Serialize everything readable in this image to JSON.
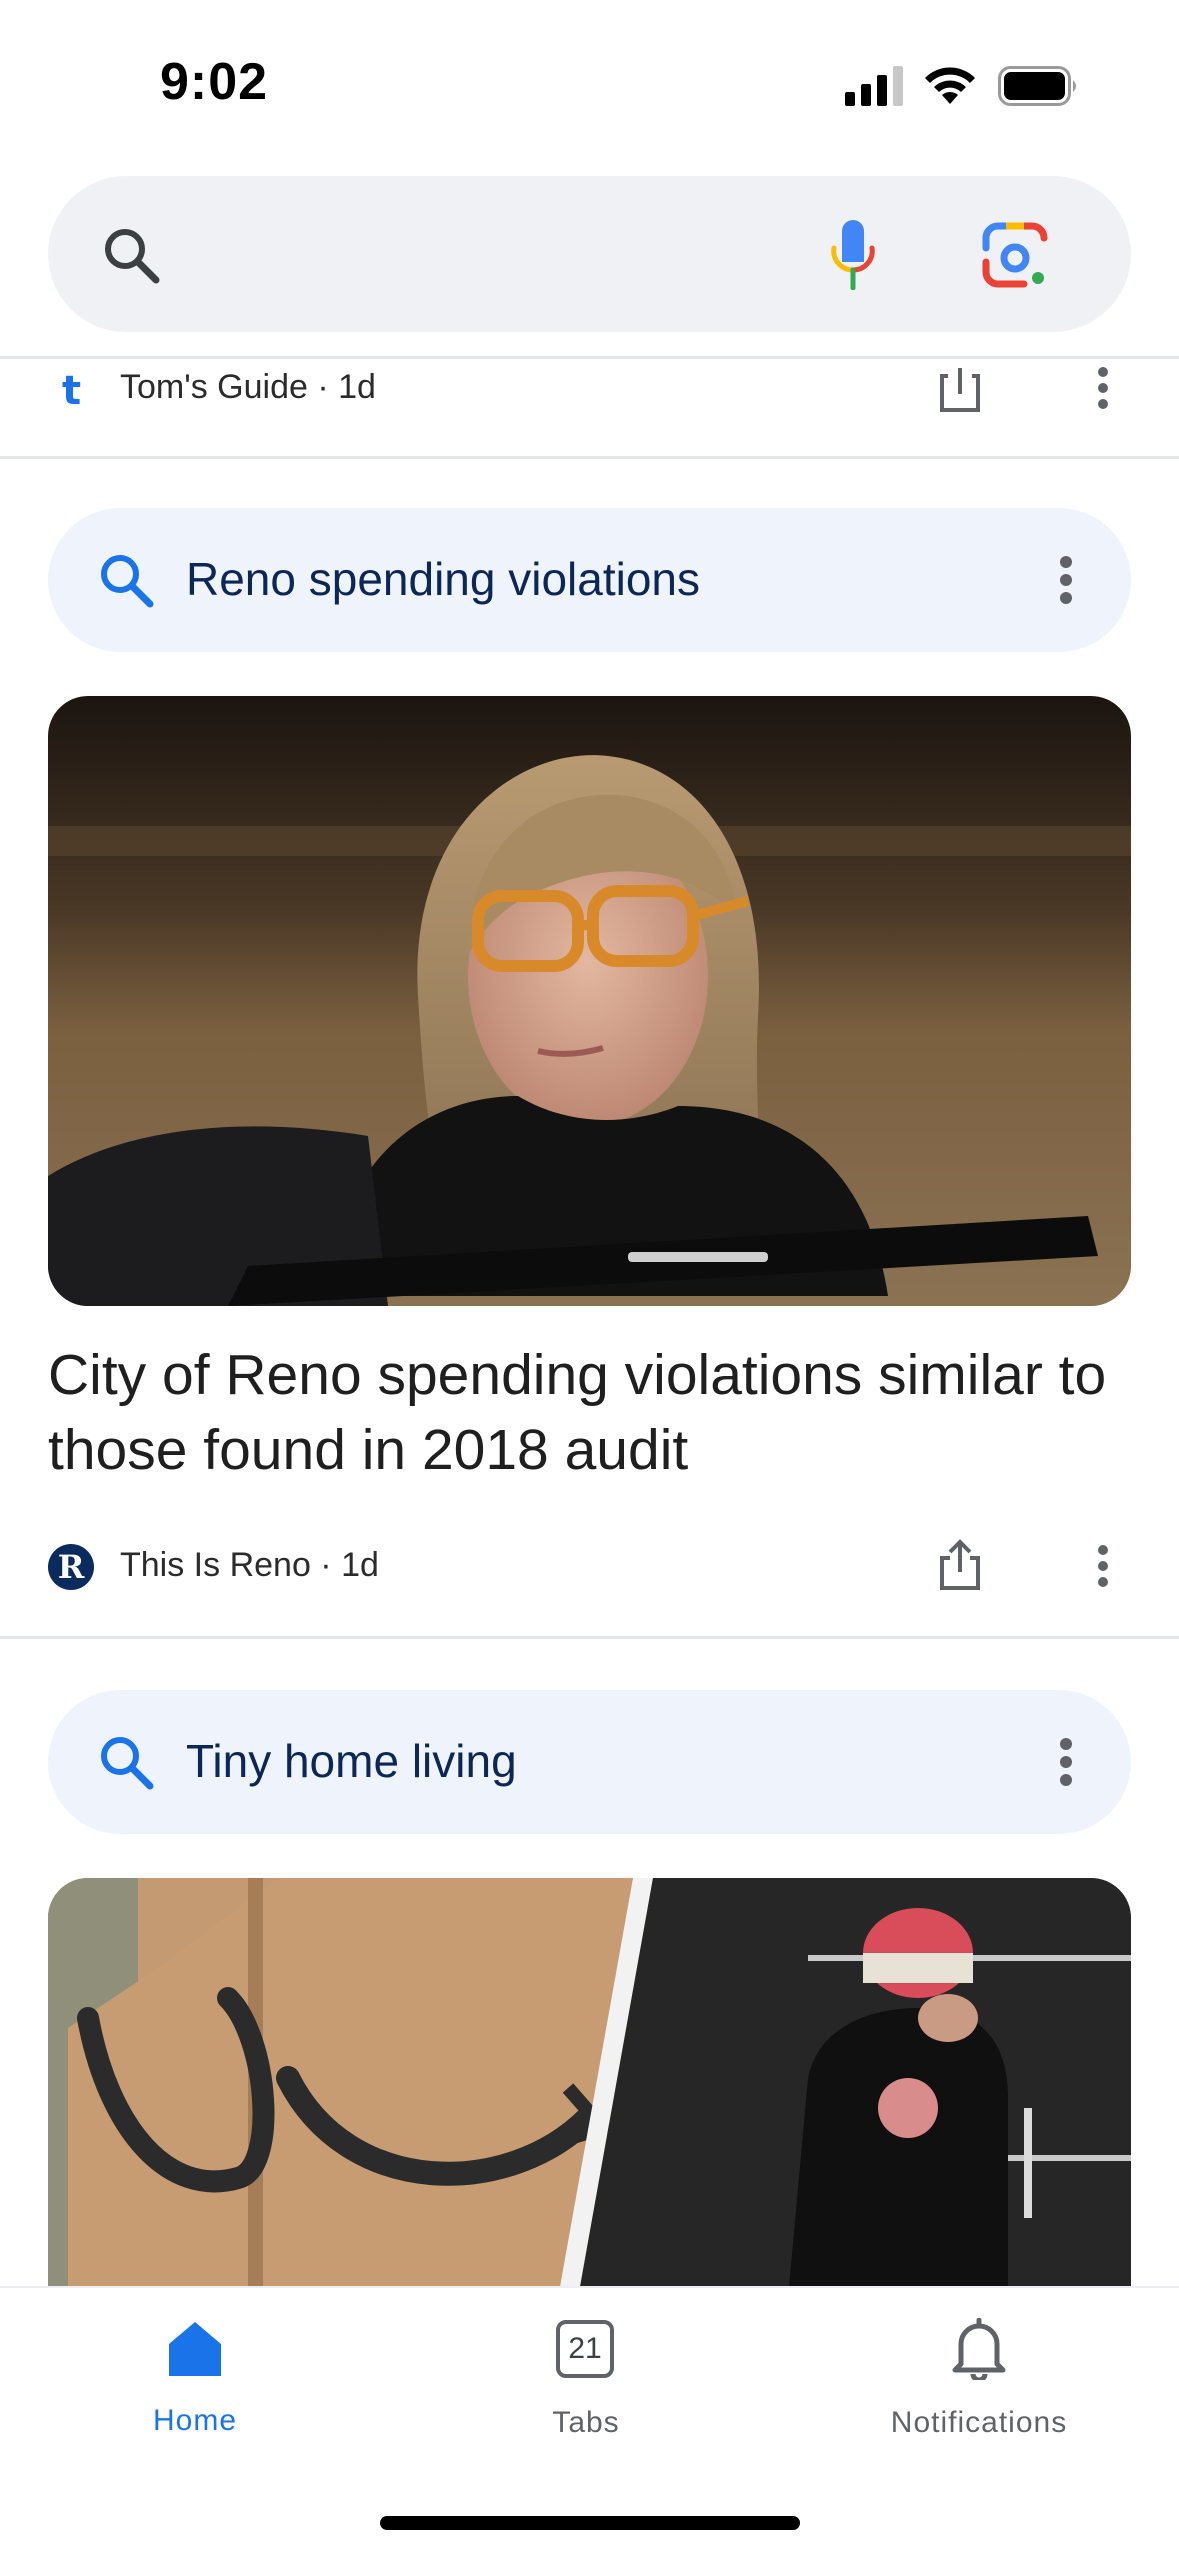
{
  "status_bar": {
    "time": "9:02"
  },
  "search": {
    "placeholder": ""
  },
  "partial_card": {
    "source": "Tom's Guide · 1d"
  },
  "cards": [
    {
      "topic": "Reno spending violations",
      "headline": "City of Reno spending violations similar to those found in 2018 audit",
      "source": "This Is Reno · 1d",
      "source_logo_letter": "R"
    },
    {
      "topic": "Tiny home living"
    }
  ],
  "bottom_nav": {
    "home_label": "Home",
    "tabs_label": "Tabs",
    "tabs_count": "21",
    "notifications_label": "Notifications"
  },
  "colors": {
    "accent_blue": "#1a73e8",
    "pill_bg": "#eff4fc",
    "search_bg": "#f0f1f4"
  }
}
